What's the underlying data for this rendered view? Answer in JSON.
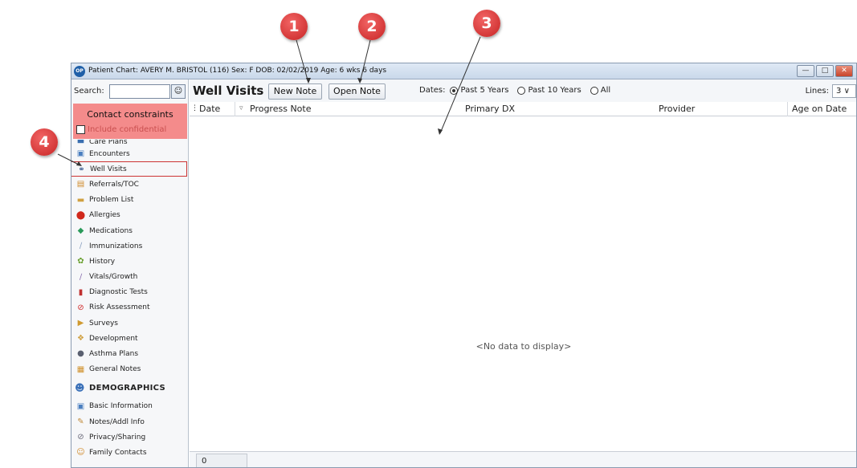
{
  "window": {
    "title": "Patient Chart: AVERY M. BRISTOL (116)  Sex: F  DOB: 02/02/2019  Age: 6 wks 6 days",
    "app_icon_text": "OP",
    "minimize": "—",
    "maximize": "□",
    "close": "✕"
  },
  "sidebar": {
    "search_label": "Search:",
    "search_value": "",
    "search_icon": "person-search-icon",
    "contact_constraints": "Contact constraints",
    "include_confidential": "Include confidential",
    "items": [
      {
        "label": "Care Plans",
        "icon": "care-plans-icon"
      },
      {
        "label": "Encounters",
        "icon": "encounters-icon"
      },
      {
        "label": "Well Visits",
        "icon": "stethoscope-icon"
      },
      {
        "label": "Referrals/TOC",
        "icon": "referrals-icon"
      },
      {
        "label": "Problem List",
        "icon": "problem-list-icon"
      },
      {
        "label": "Allergies",
        "icon": "allergies-icon"
      },
      {
        "label": "Medications",
        "icon": "medications-icon"
      },
      {
        "label": "Immunizations",
        "icon": "syringe-icon"
      },
      {
        "label": "History",
        "icon": "history-icon"
      },
      {
        "label": "Vitals/Growth",
        "icon": "vitals-icon"
      },
      {
        "label": "Diagnostic Tests",
        "icon": "test-tubes-icon"
      },
      {
        "label": "Risk Assessment",
        "icon": "risk-icon"
      },
      {
        "label": "Surveys",
        "icon": "surveys-icon"
      },
      {
        "label": "Development",
        "icon": "development-icon"
      },
      {
        "label": "Asthma Plans",
        "icon": "asthma-icon"
      },
      {
        "label": "General Notes",
        "icon": "general-notes-icon"
      }
    ],
    "demographics_heading": "DEMOGRAPHICS",
    "demographics_items": [
      {
        "label": "Basic Information",
        "icon": "id-card-icon"
      },
      {
        "label": "Notes/Addl Info",
        "icon": "notes-icon"
      },
      {
        "label": "Privacy/Sharing",
        "icon": "privacy-icon"
      },
      {
        "label": "Family Contacts",
        "icon": "family-icon"
      }
    ]
  },
  "main": {
    "title": "Well Visits",
    "new_note": "New Note",
    "open_note": "Open Note",
    "dates_label": "Dates:",
    "date_options": [
      {
        "label": "Past 5 Years",
        "selected": true
      },
      {
        "label": "Past 10 Years",
        "selected": false
      },
      {
        "label": "All",
        "selected": false
      }
    ],
    "lines_label": "Lines:",
    "lines_value": "3",
    "columns": [
      "Date",
      "Progress Note",
      "Primary DX",
      "Provider",
      "Age on Date"
    ],
    "no_data": "<No data to display>",
    "row_count": "0"
  },
  "callouts": [
    "1",
    "2",
    "3",
    "4"
  ],
  "colors": {
    "callout": "#d63434",
    "contact_box": "#f48b8b",
    "highlight_border": "#cc3333"
  }
}
